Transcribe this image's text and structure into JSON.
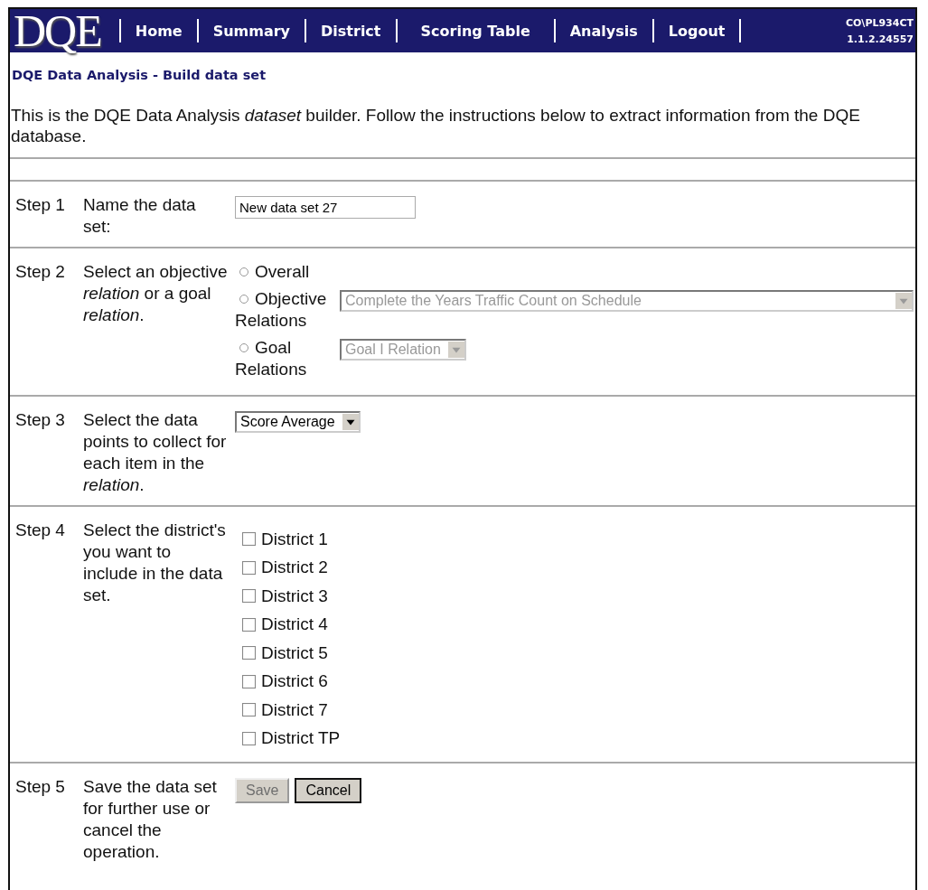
{
  "header": {
    "logo": "DQE",
    "nav": [
      {
        "label": "Home"
      },
      {
        "label": "Summary"
      },
      {
        "label": "District"
      },
      {
        "label": "Scoring Table"
      },
      {
        "label": "Analysis"
      },
      {
        "label": "Logout"
      }
    ],
    "user": "CO\\PL934CT",
    "version": "1.1.2.24557"
  },
  "heading": "DQE Data Analysis - Build data set",
  "intro": "This is the DQE Data Analysis *dataset* builder. Follow the instructions below to extract information from the DQE database.",
  "steps": [
    {
      "kind": "name",
      "label": "Step 1",
      "text": "Name the data set:",
      "value": "New data set 27"
    },
    {
      "kind": "relation",
      "label": "Step 2",
      "text": "Select an objective *relation* or a goal *relation*.",
      "options": [
        {
          "label": "Overall",
          "selected": false
        },
        {
          "label": "Objective Relations",
          "selected": false,
          "select": {
            "value": "Complete the Years Traffic Count on Schedule",
            "disabled": true,
            "wide": true
          }
        },
        {
          "label": "Goal Relations",
          "selected": false,
          "select": {
            "value": "Goal I Relation",
            "disabled": true,
            "wide": false
          }
        }
      ]
    },
    {
      "kind": "points",
      "label": "Step 3",
      "text": "Select the data points to collect for each item in the *relation*.",
      "select": {
        "value": "Score Average",
        "disabled": false
      }
    },
    {
      "kind": "districts",
      "label": "Step 4",
      "text": "Select the district's you want to include in the data set.",
      "districts": [
        {
          "label": "District 1",
          "checked": false
        },
        {
          "label": "District 2",
          "checked": false
        },
        {
          "label": "District 3",
          "checked": false
        },
        {
          "label": "District 4",
          "checked": false
        },
        {
          "label": "District 5",
          "checked": false
        },
        {
          "label": "District 6",
          "checked": false
        },
        {
          "label": "District 7",
          "checked": false
        },
        {
          "label": "District TP",
          "checked": false
        }
      ]
    },
    {
      "kind": "actions",
      "label": "Step 5",
      "text": "Save the data set for further use or cancel the operation.",
      "buttons": [
        {
          "label": "Save",
          "disabled": true
        },
        {
          "label": "Cancel",
          "disabled": false
        }
      ]
    }
  ]
}
